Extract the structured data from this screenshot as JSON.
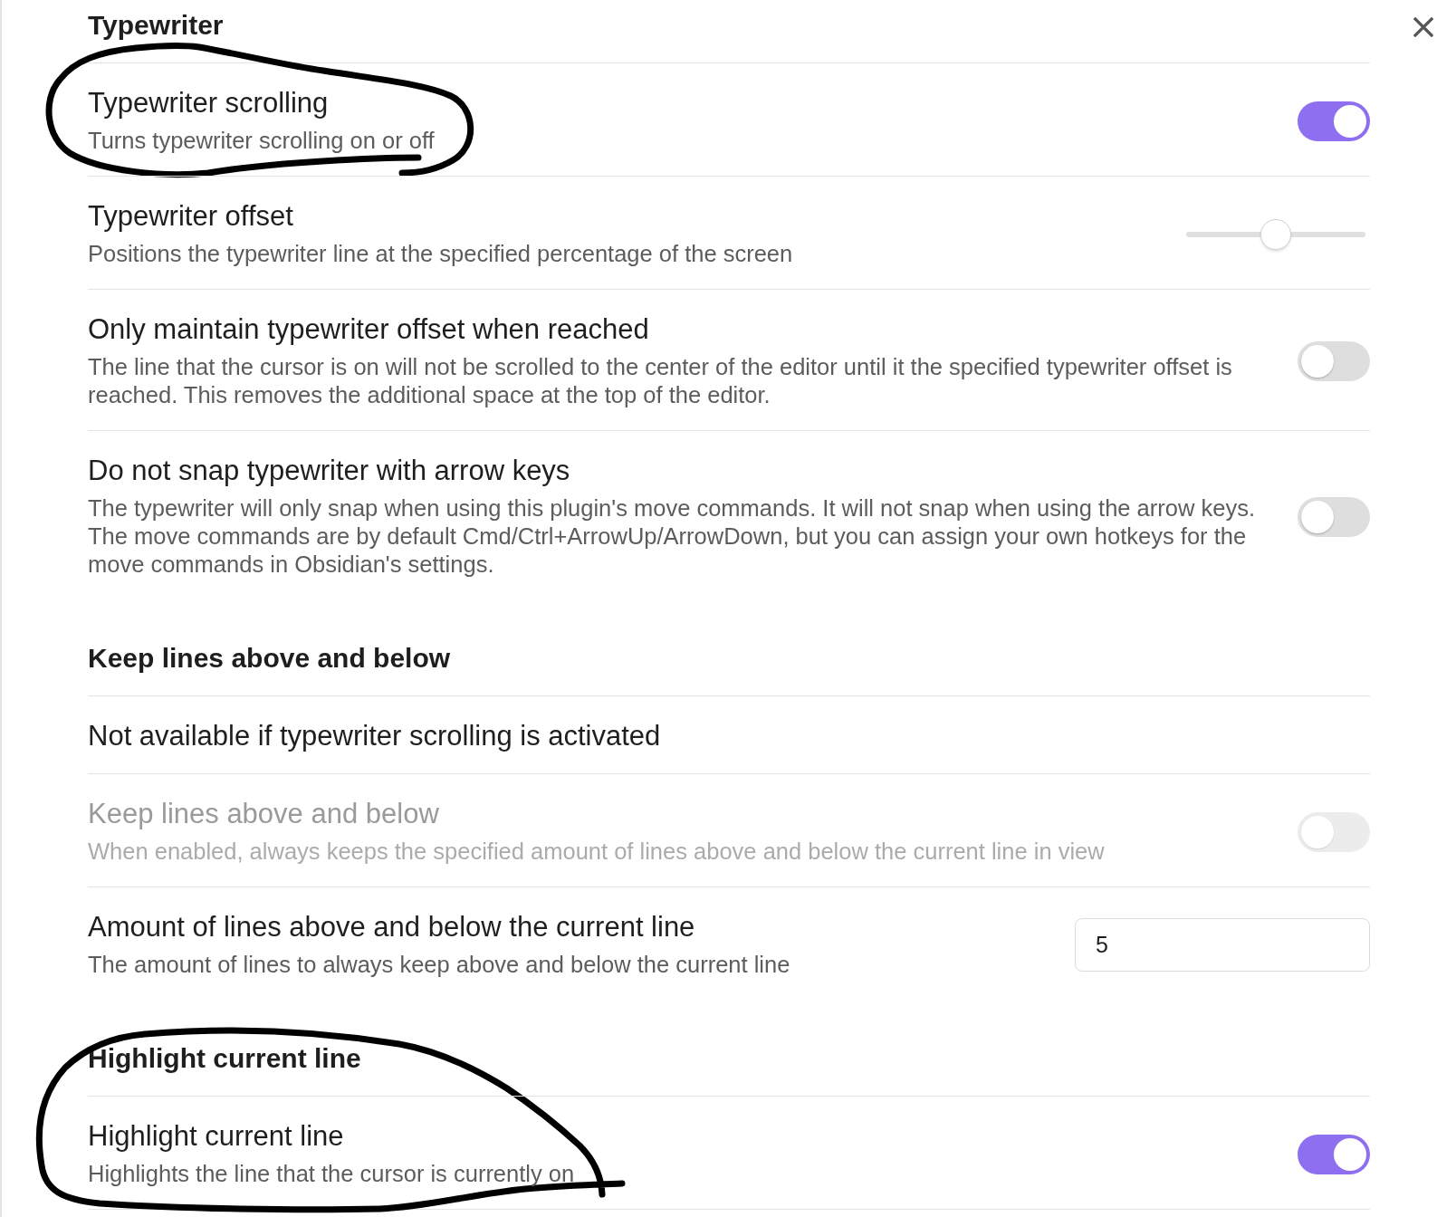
{
  "sections": [
    {
      "heading": "Typewriter",
      "circled": false,
      "items": [
        {
          "kind": "toggle",
          "name": "Typewriter scrolling",
          "description": "Turns typewriter scrolling on or off",
          "on": true,
          "disabled": false,
          "circled": true
        },
        {
          "kind": "slider",
          "name": "Typewriter offset",
          "description": "Positions the typewriter line at the specified percentage of the screen",
          "level": 0.5,
          "disabled": false,
          "circled": false
        },
        {
          "kind": "toggle",
          "name": "Only maintain typewriter offset when reached",
          "description": "The line that the cursor is on will not be scrolled to the center of the editor until it the specified typewriter offset is reached. This removes the additional space at the top of the editor.",
          "on": false,
          "disabled": false,
          "circled": false
        },
        {
          "kind": "toggle",
          "name": "Do not snap typewriter with arrow keys",
          "description": "The typewriter will only snap when using this plugin's move commands. It will not snap when using the arrow keys. The move commands are by default Cmd/Ctrl+ArrowUp/ArrowDown, but you can assign your own hotkeys for the move commands in Obsidian's settings.",
          "on": false,
          "disabled": false,
          "circled": false
        }
      ]
    },
    {
      "heading": "Keep lines above and below",
      "circled": false,
      "items": [
        {
          "kind": "note",
          "name": "Not available if typewriter scrolling is activated",
          "disabled": false,
          "circled": false
        },
        {
          "kind": "toggle",
          "name": "Keep lines above and below",
          "description": "When enabled, always keeps the specified amount of lines above and below the current line in view",
          "on": false,
          "disabled": true,
          "circled": false
        },
        {
          "kind": "number",
          "name": "Amount of lines above and below the current line",
          "description": "The amount of lines to always keep above and below the current line",
          "value": "5",
          "disabled": false,
          "circled": false
        }
      ]
    },
    {
      "heading": "Highlight current line",
      "circled": true,
      "items": [
        {
          "kind": "toggle",
          "name": "Highlight current line",
          "description": "Highlights the line that the cursor is currently on",
          "on": true,
          "disabled": false,
          "circled": false
        }
      ]
    }
  ]
}
